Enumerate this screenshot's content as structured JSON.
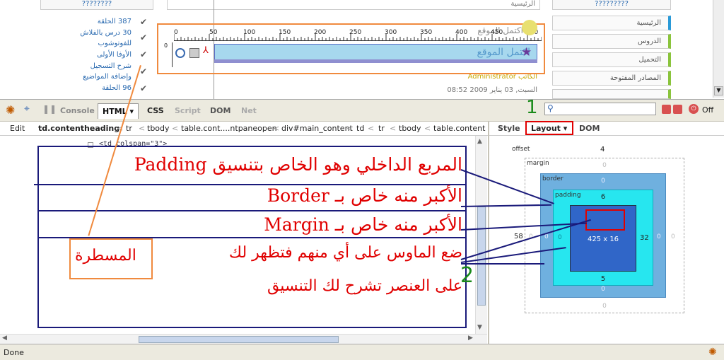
{
  "webpage": {
    "top_left_link": "????????",
    "top_right_link": "?????????",
    "top_middle_text": "الرئيسية",
    "left_list": [
      "387 الحلقة",
      "30 درس بالفلاش",
      "للفوتوشوب",
      "الأوفا الأولى",
      "شرح التسجيل",
      "وإضافة المواضيع",
      "96 الحلقة"
    ],
    "right_menu": [
      "الرئيسية",
      "الدروس",
      "التحميل",
      "المصادر المفتوحة"
    ],
    "band_text": "اكتمل الموقع",
    "author": "الكاتب Administrator",
    "date": "السبت, 03 يناير 2009 08:52",
    "ruler_ticks": [
      "0",
      "50",
      "100",
      "150",
      "200",
      "250",
      "300",
      "350",
      "400",
      "450",
      "500"
    ]
  },
  "toolbar": {
    "tabs": [
      "Console",
      "HTML",
      "CSS",
      "Script",
      "DOM",
      "Net"
    ],
    "active_tab": "HTML",
    "search_placeholder": "",
    "off_label": "Off"
  },
  "breadcrumbs": {
    "edit": "Edit",
    "items": [
      "td.contentheading",
      "tr",
      "tbody",
      "table.cont....ntpaneopen",
      "div#main_content",
      "td",
      "tr",
      "tbody",
      "table.content"
    ]
  },
  "side_tabs": {
    "style": "Style",
    "layout": "Layout",
    "dom": "DOM"
  },
  "tree": {
    "code_line": "<td colspan=\"3\">"
  },
  "layout": {
    "offset_label": "offset",
    "offset_top": "4",
    "offset_left": "58",
    "margin_label": "margin",
    "margin_top": "0",
    "margin_bottom": "0",
    "margin_left": "0",
    "margin_right": "0",
    "border_label": "border",
    "border_top": "0",
    "border_bottom": "0",
    "border_left": "0",
    "border_right": "0",
    "padding_label": "padding",
    "padding_top": "6",
    "padding_bottom": "5",
    "padding_left": "0",
    "padding_right": "32",
    "content_size": "425 x 16"
  },
  "annotations": {
    "line1": "المربع الداخلي وهو الخاص بتنسيق Padding",
    "line2": "الأكبر منه خاص بـ Border",
    "line3": "الأكبر منه خاص بـ Margin",
    "line4a": "ضع الماوس على أي منهم فتظهر لك",
    "line4b": "المسطرة",
    "line5": "على العنصر تشرح لك التنسيق",
    "step1": "1",
    "step2": "2"
  },
  "status": {
    "text": "Done"
  },
  "colors": {
    "annotation": "#e00000",
    "frame": "#1a1a7a",
    "highlight": "#f08a3e",
    "step": "#1a8a1a"
  }
}
